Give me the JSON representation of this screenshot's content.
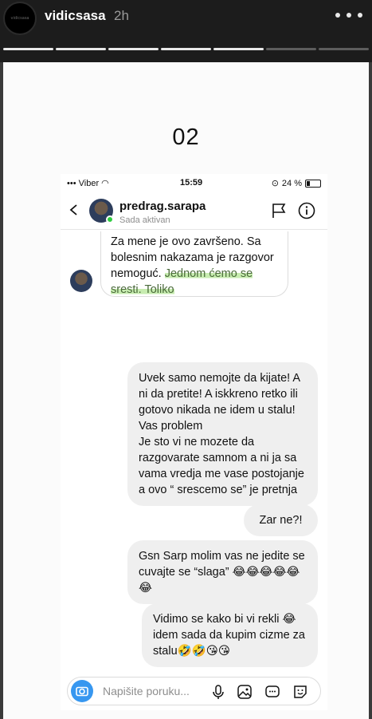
{
  "story": {
    "username": "vidicsasa",
    "time_ago": "2h",
    "avatar_text": "vidicsasa",
    "slide_number": "02"
  },
  "phone_status": {
    "carrier": "Viber",
    "time": "15:59",
    "battery": "24 %"
  },
  "dm_header": {
    "name": "predrag.sarapa",
    "status": "Sada aktivan"
  },
  "messages": {
    "incoming_part1": "Za mene je ovo završeno. Sa bolesnim nakazama je razgovor nemoguć.",
    "incoming_part2": "Jednom ćemo se sresti. Toliko",
    "m1": "Uvek samo nemojte da  kijate! A ni da pretite! A iskkreno retko ili gotovo nikada ne idem u stalu! Vas problem\nJe sto vi ne mozete da razgovarate samnom a ni ja sa vama vredja me vase postojanje a ovo “ srescemo  se” je pretnja",
    "m2": "Zar ne?!",
    "m3": "Gsn Sarp molim vas ne jedite se cuvajte  se “slaga” 😂😂😂😂😂😂",
    "m4": "Vidimo se  kako bi vi rekli 😂 idem sada da kupim cizme za stalu🤣🤣😘😘"
  },
  "composer": {
    "placeholder": "Napišite poruku..."
  },
  "colors": {
    "accent": "#3797f0",
    "online": "#2ecc40",
    "highlight": "#c7ecb0"
  },
  "icons": [
    "more-icon",
    "back-icon",
    "flag-icon",
    "info-icon",
    "camera-icon",
    "mic-icon",
    "image-icon",
    "sticker-icon",
    "smiley-icon"
  ]
}
